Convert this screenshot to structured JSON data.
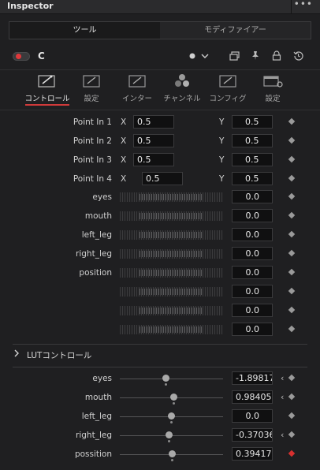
{
  "titlebar": {
    "title": "Inspector",
    "more": "•••"
  },
  "tabs": [
    {
      "label": "ツール",
      "active": true
    },
    {
      "label": "モディファイアー",
      "active": false
    }
  ],
  "node": {
    "name": "C",
    "enabled": true
  },
  "control_tabs": [
    {
      "label": "コントロール",
      "icon": "controls-icon",
      "active": true
    },
    {
      "label": "設定",
      "icon": "settings-icon",
      "active": false
    },
    {
      "label": "インター",
      "icon": "inter-icon",
      "active": false
    },
    {
      "label": "チャンネル",
      "icon": "channels-icon",
      "active": false
    },
    {
      "label": "コンフィグ",
      "icon": "config-icon",
      "active": false
    },
    {
      "label": "設定",
      "icon": "display-settings-icon",
      "active": false
    }
  ],
  "points": [
    {
      "label": "Point In 1",
      "x_label": "X",
      "x": "0.5",
      "y_label": "Y",
      "y": "0.5"
    },
    {
      "label": "Point In 2",
      "x_label": "X",
      "x": "0.5",
      "y_label": "Y",
      "y": "0.5"
    },
    {
      "label": "Point In 3",
      "x_label": "X",
      "x": "0.5",
      "y_label": "Y",
      "y": "0.5"
    },
    {
      "label": "Point In 4",
      "x_label": "X",
      "x": "0.5",
      "y_label": "Y",
      "y": "0.5"
    }
  ],
  "param_rows": [
    {
      "label": "eyes",
      "value": "0.0"
    },
    {
      "label": "mouth",
      "value": "0.0"
    },
    {
      "label": "left_leg",
      "value": "0.0"
    },
    {
      "label": "right_leg",
      "value": "0.0"
    },
    {
      "label": "position",
      "value": "0.0"
    },
    {
      "label": "",
      "value": "0.0"
    },
    {
      "label": "",
      "value": "0.0"
    },
    {
      "label": "",
      "value": "0.0"
    }
  ],
  "lut_section": {
    "title": "LUTコントロール",
    "expanded": false
  },
  "lut_rows": [
    {
      "label": "eyes",
      "value": "-1.89817",
      "level": 0.45,
      "red_key": false
    },
    {
      "label": "mouth",
      "value": "0.984056",
      "level": 0.52,
      "red_key": false
    },
    {
      "label": "left_leg",
      "value": "0.0",
      "level": 0.5,
      "red_key": false
    },
    {
      "label": "right_leg",
      "value": "-0.370360",
      "level": 0.48,
      "red_key": false
    },
    {
      "label": "possition",
      "value": "0.394177",
      "level": 0.51,
      "red_key": true
    }
  ]
}
